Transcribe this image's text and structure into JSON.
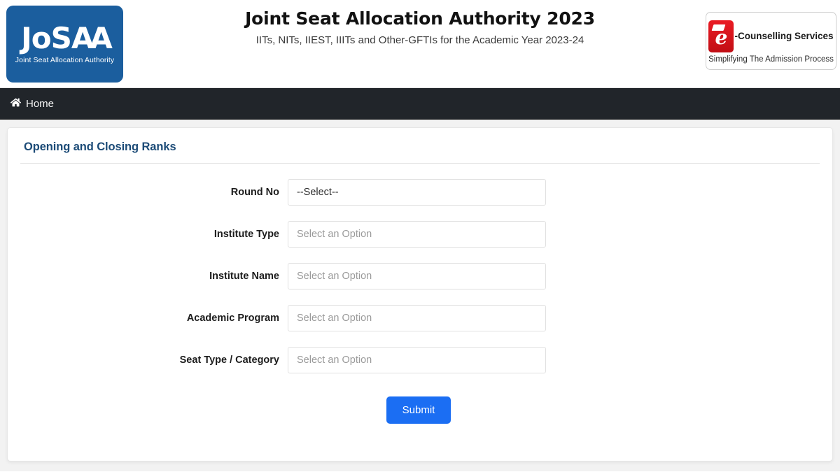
{
  "header": {
    "title": "Joint Seat Allocation Authority 2023",
    "subtitle": "IITs, NITs, IIEST, IIITs and Other-GFTIs for the Academic Year 2023-24",
    "left_logo": {
      "wordmark_part1": "JoS",
      "wordmark_part2": "AA",
      "tagline": "Joint Seat Allocation Authority",
      "color": "#1b5e9e"
    },
    "right_logo": {
      "mark_letter": "e",
      "name": "-Counselling Services",
      "tagline": "Simplifying The Admission Process",
      "color": "#ea1c24"
    }
  },
  "navbar": {
    "background": "#21252a",
    "items": [
      {
        "label": "Home",
        "icon": "home-icon"
      }
    ]
  },
  "card": {
    "title": "Opening and Closing Ranks",
    "title_color": "#1c4b77",
    "fields": [
      {
        "label": "Round No",
        "value": "--Select--",
        "state": "value-dark"
      },
      {
        "label": "Institute Type",
        "value": "Select an Option",
        "state": "placeholder"
      },
      {
        "label": "Institute Name",
        "value": "Select an Option",
        "state": "placeholder"
      },
      {
        "label": "Academic Program",
        "value": "Select an Option",
        "state": "placeholder"
      },
      {
        "label": "Seat Type / Category",
        "value": "Select an Option",
        "state": "placeholder"
      }
    ],
    "submit_label": "Submit",
    "submit_color": "#1b6ef3"
  }
}
